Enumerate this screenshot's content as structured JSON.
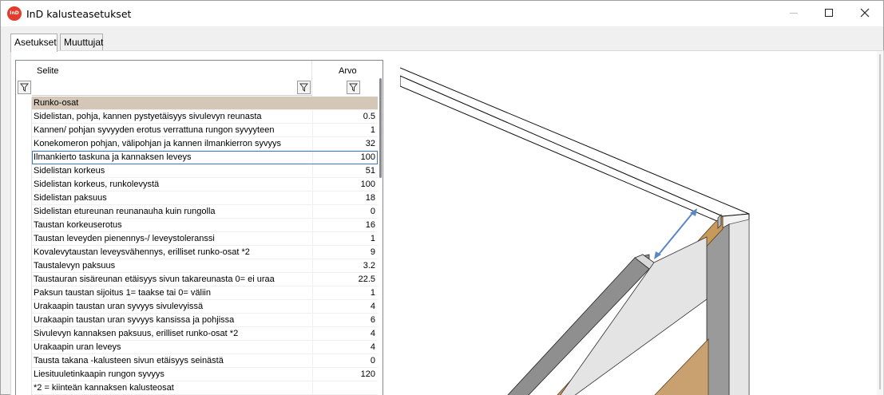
{
  "window": {
    "icon_label": "InD",
    "title": "InD kalusteasetukset"
  },
  "tabs": [
    {
      "label": "Asetukset",
      "active": true
    },
    {
      "label": "Muuttujat",
      "active": false
    }
  ],
  "grid": {
    "columns": {
      "label": "Selite",
      "value": "Arvo"
    },
    "rows": [
      {
        "label": "Runko-osat",
        "value": "",
        "group": true
      },
      {
        "label": "Sidelistan, pohja, kannen pystyetäisyys sivulevyn reunasta",
        "value": "0.5"
      },
      {
        "label": "Kannen/ pohjan syvyyden erotus verrattuna rungon syvyyteen",
        "value": "1"
      },
      {
        "label": "Konekomeron pohjan, välipohjan ja kannen ilmankierron syvyys",
        "value": "32"
      },
      {
        "label": "Ilmankierto taskuna ja kannaksen leveys",
        "value": "100",
        "selected": true
      },
      {
        "label": "Sidelistan korkeus",
        "value": "51"
      },
      {
        "label": "Sidelistan korkeus, runkolevystä",
        "value": "100"
      },
      {
        "label": "Sidelistan paksuus",
        "value": "18"
      },
      {
        "label": "Sidelistan etureunan reunanauha kuin rungolla",
        "value": "0"
      },
      {
        "label": "Taustan korkeuserotus",
        "value": "16"
      },
      {
        "label": "Taustan leveyden pienennys-/ leveystoleranssi",
        "value": "1"
      },
      {
        "label": "Kovalevytaustan leveysvähennys, erilliset runko-osat *2",
        "value": "9"
      },
      {
        "label": "Taustalevyn paksuus",
        "value": "3.2"
      },
      {
        "label": "Taustauran sisäreunan etäisyys sivun takareunasta 0= ei uraa",
        "value": "22.5"
      },
      {
        "label": "Paksun taustan sijoitus 1= taakse tai 0= väliin",
        "value": "1"
      },
      {
        "label": "Urakaapin taustan uran syvyys sivulevyissä",
        "value": "4"
      },
      {
        "label": "Urakaapin taustan uran syvyys kansissa ja pohjissa",
        "value": "6"
      },
      {
        "label": "Sivulevyn kannaksen paksuus, erilliset runko-osat *2",
        "value": "4"
      },
      {
        "label": "Urakaapin uran leveys",
        "value": "4"
      },
      {
        "label": "Tausta takana -kalusteen sivun etäisyys seinästä",
        "value": "0"
      },
      {
        "label": "Liesituuletinkaapin rungon syvyys",
        "value": "120"
      },
      {
        "label": "*2 = kiinteän kannaksen kalusteosat",
        "value": ""
      }
    ]
  },
  "colors": {
    "group_row": "#d5c7b8",
    "selection_border": "#3c78c8",
    "arrow": "#5b86c5",
    "wood_edge": "#c79a5c",
    "board_grey": "#8f8f8f"
  }
}
